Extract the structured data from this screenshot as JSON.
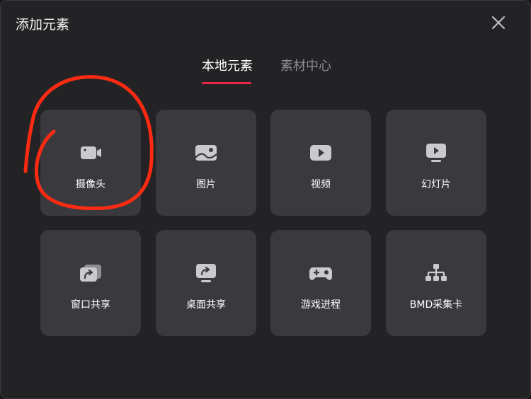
{
  "dialog": {
    "title": "添加元素",
    "close_icon": "close-icon"
  },
  "tabs": [
    {
      "label": "本地元素",
      "active": true
    },
    {
      "label": "素材中心",
      "active": false
    }
  ],
  "tiles": [
    {
      "label": "摄像头",
      "icon": "camera-icon"
    },
    {
      "label": "图片",
      "icon": "image-icon"
    },
    {
      "label": "视频",
      "icon": "video-icon"
    },
    {
      "label": "幻灯片",
      "icon": "slideshow-icon"
    },
    {
      "label": "窗口共享",
      "icon": "window-share-icon"
    },
    {
      "label": "桌面共享",
      "icon": "desktop-share-icon"
    },
    {
      "label": "游戏进程",
      "icon": "gamepad-icon"
    },
    {
      "label": "BMD采集卡",
      "icon": "capture-card-icon"
    }
  ],
  "colors": {
    "background": "#232325",
    "tile": "#3a3a3e",
    "icon": "#c9c9cf",
    "accent": "#e8284a",
    "annotation": "#ff2a12"
  }
}
